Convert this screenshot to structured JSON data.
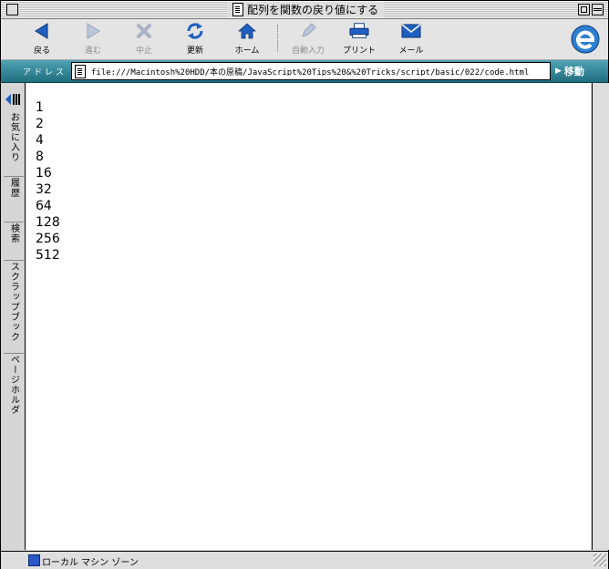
{
  "window": {
    "title": "配列を関数の戻り値にする"
  },
  "toolbar": {
    "buttons": [
      {
        "label": "戻る",
        "icon": "back-arrow-icon",
        "enabled": true
      },
      {
        "label": "進む",
        "icon": "forward-arrow-icon",
        "enabled": false
      },
      {
        "label": "中止",
        "icon": "stop-icon",
        "enabled": false
      },
      {
        "label": "更新",
        "icon": "refresh-icon",
        "enabled": true
      },
      {
        "label": "ホーム",
        "icon": "home-icon",
        "enabled": true
      },
      {
        "label": "自動入力",
        "icon": "autofill-icon",
        "enabled": false
      },
      {
        "label": "プリント",
        "icon": "printer-icon",
        "enabled": true
      },
      {
        "label": "メール",
        "icon": "mail-icon",
        "enabled": true
      }
    ],
    "logo": "ie-logo"
  },
  "address": {
    "label": "アドレス :",
    "url": "file:///Macintosh%20HDD/本の原稿/JavaScript%20Tips%20&%20Tricks/script/basic/022/code.html",
    "go_label": "移動"
  },
  "explorer": {
    "tabs": [
      "お気に入り",
      "履歴",
      "検索",
      "スクラップブック",
      "ページホルダ"
    ]
  },
  "content": {
    "lines": [
      "1",
      "2",
      "4",
      "8",
      "16",
      "32",
      "64",
      "128",
      "256",
      "512"
    ]
  },
  "status": {
    "text": "ローカル マシン ゾーン"
  },
  "colors": {
    "address_bar": "#2b7d8e",
    "icon_blue": "#1f5fc0",
    "icon_disabled": "#9aa4b8"
  }
}
